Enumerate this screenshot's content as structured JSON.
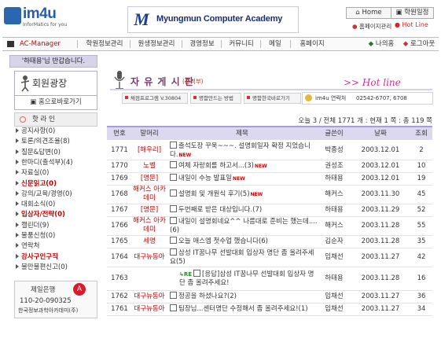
{
  "header": {
    "logo_text": "im4u",
    "logo_sub": "InforMatics for you",
    "academy_mark": "M",
    "academy_name": "Myungmun Computer Academy",
    "home_label": "Home",
    "schedule_label": "학원일정",
    "homepage_admin": "홈페이지관리",
    "hotline": "Hot Line"
  },
  "topnav": {
    "ac_manager": "AC-Manager",
    "items": [
      "학원정보관리",
      "원생정보관리",
      "경영정보",
      "커뮤니티",
      "메일",
      "홈페이지"
    ],
    "my_info": "나의홈",
    "logout": "로그아웃"
  },
  "sidebar": {
    "welcome": "'하태용'님 반갑습니다.",
    "plaza_title": "회원광장",
    "home_shortcut": "홈으로바로가기",
    "hotline_label": "핫 라 인",
    "items": [
      {
        "label": "공지사항(0)",
        "color": "#333333"
      },
      {
        "label": "토론/의견조율(8)",
        "color": "#333333"
      },
      {
        "label": "질문&답변(0)",
        "color": "#333333"
      },
      {
        "label": "한마디(출석부)(4)",
        "color": "#333333"
      },
      {
        "label": "자료실(0)",
        "color": "#333333"
      },
      {
        "label": "신문읽고(0)",
        "color": "#c00000"
      },
      {
        "label": "강의/교육/경영(0)",
        "color": "#333333"
      },
      {
        "label": "대회소식(0)",
        "color": "#333333"
      },
      {
        "label": "입상자/전략(0)",
        "color": "#c00000"
      },
      {
        "label": "캘린더(9)",
        "color": "#333333"
      },
      {
        "label": "물품신청(0)",
        "color": "#333333"
      },
      {
        "label": "연락처",
        "color": "#333333"
      },
      {
        "label": "강사구인구직",
        "color": "#c00000"
      },
      {
        "label": "불만불편신고(0)",
        "color": "#333333"
      }
    ],
    "bank": {
      "name": "제일은행",
      "account": "110-20-090325",
      "holder": "한국정보과학아카데미(주)"
    }
  },
  "board": {
    "title": "자 유 게 시 판",
    "subtitle": "(출석부)",
    "hotline_tag": ">> Hot line",
    "pills": [
      "채점프로그램 V.30804",
      "명함만드는 방법",
      "명함한국바로가기"
    ],
    "msg_label": "im4u 연락처",
    "msg_number": "02542-6707, 6708",
    "stats": "오늘 3 / 전체 1771 개 : 현재 1 쪽 : 총 119 쪽",
    "columns": [
      "번호",
      "말머리",
      "제목",
      "글쓴이",
      "날짜",
      "조회"
    ],
    "rows": [
      {
        "no": "1771",
        "head": "[해우리]",
        "head_color": "#c00000",
        "title": "출석도장 꾸욱~~~. 설명회일자 확정 지었습니다.",
        "new": true,
        "re": false,
        "writer": "박종성",
        "date": "2003.12.01",
        "views": "2"
      },
      {
        "no": "1770",
        "head": "노벨",
        "head_color": "#c00000",
        "title": "여체 자랑회를 하고서...(3)",
        "new": true,
        "re": false,
        "writer": "권성조",
        "date": "2003.12.01",
        "views": "10"
      },
      {
        "no": "1769",
        "head": "[명문]",
        "head_color": "#c00000",
        "title": "내일이 수능 발표일",
        "new": true,
        "re": false,
        "writer": "하태용",
        "date": "2003.12.01",
        "views": "19"
      },
      {
        "no": "1768",
        "head": "해커스 아카데미",
        "head_color": "#c00000",
        "title": "설명회 및 개원식 후기(5)",
        "new": true,
        "re": false,
        "writer": "해커스",
        "date": "2003.11.30",
        "views": "45"
      },
      {
        "no": "1767",
        "head": "[명문]",
        "head_color": "#c00000",
        "title": "두번째로 받은 대상입니다.(7)",
        "new": false,
        "re": false,
        "writer": "하태용",
        "date": "2003.11.29",
        "views": "52"
      },
      {
        "no": "1766",
        "head": "해커스 아카데미",
        "head_color": "#c00000",
        "title": "내일이 설명회네요^^ 나름대로 준비는 했는데....(6)",
        "new": false,
        "re": false,
        "writer": "해커스",
        "date": "2003.11.28",
        "views": "55"
      },
      {
        "no": "1765",
        "head": "세명",
        "head_color": "#c00000",
        "title": "오늘 애스엠 첫수업 했습니다(6)",
        "new": false,
        "re": false,
        "writer": "김순자",
        "date": "2003.11.28",
        "views": "35"
      },
      {
        "no": "1764",
        "head": "대구뉴동아",
        "head_color": "#c00000",
        "title": "삼성 IT꿈나무 선발대회 입상자 명단 좀 올려주세요(5)",
        "new": false,
        "re": false,
        "writer": "임채선",
        "date": "2003.11.27",
        "views": "42"
      },
      {
        "no": "1763",
        "head": "",
        "head_color": "#c00000",
        "title": "[응답]삼성 IT꿈나무 선발대회 입상자 명단 좀 올려주세요!",
        "new": false,
        "re": true,
        "writer": "하태용",
        "date": "2003.11.28",
        "views": "16"
      },
      {
        "no": "1762",
        "head": "대구뉴동아",
        "head_color": "#c00000",
        "title": "정공을 하셨나요?(2)",
        "new": false,
        "re": false,
        "writer": "임채선",
        "date": "2003.11.27",
        "views": "36"
      },
      {
        "no": "1761",
        "head": "대구뉴동아",
        "head_color": "#c00000",
        "title": "팀장님...센터명단 수정해서 좀 올려주세요!(1)",
        "new": false,
        "re": false,
        "writer": "임채선",
        "date": "2003.11.27",
        "views": "34"
      }
    ]
  }
}
